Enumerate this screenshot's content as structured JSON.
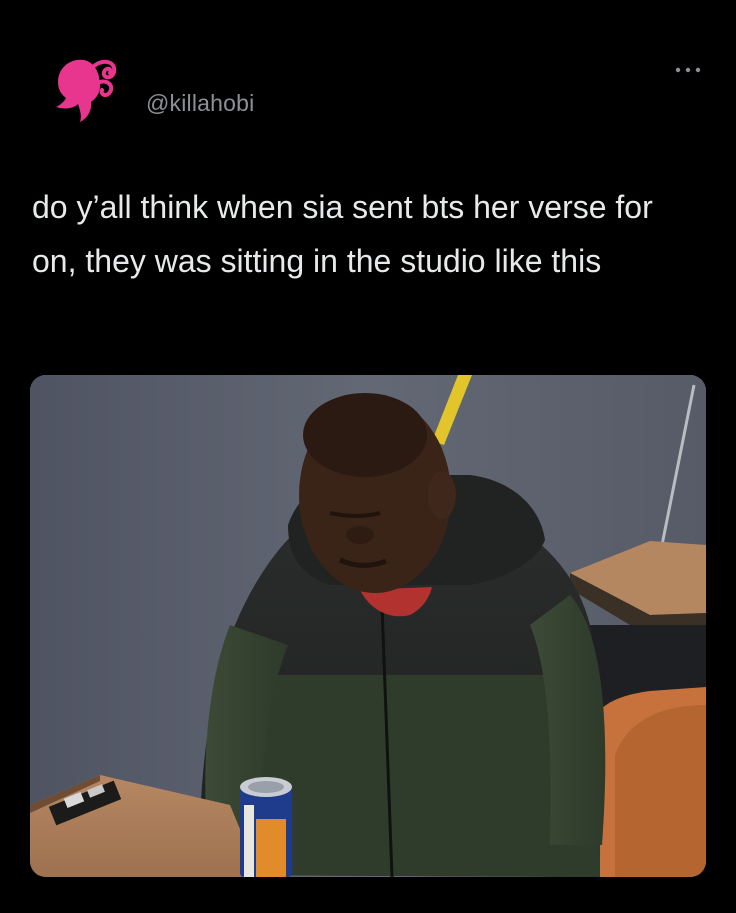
{
  "tweet": {
    "author_handle": "@killahobi",
    "avatar_icon": "barbie-silhouette-icon",
    "more_icon": "more-options-icon",
    "text": "do y’all think when sia sent bts her verse for on, they was sitting in the studio like this",
    "media_description_icon": "photo"
  },
  "colors": {
    "background": "#000000",
    "avatar_pink": "#e8368f",
    "handle_gray": "#8b9197",
    "text": "#e7e9ea"
  }
}
